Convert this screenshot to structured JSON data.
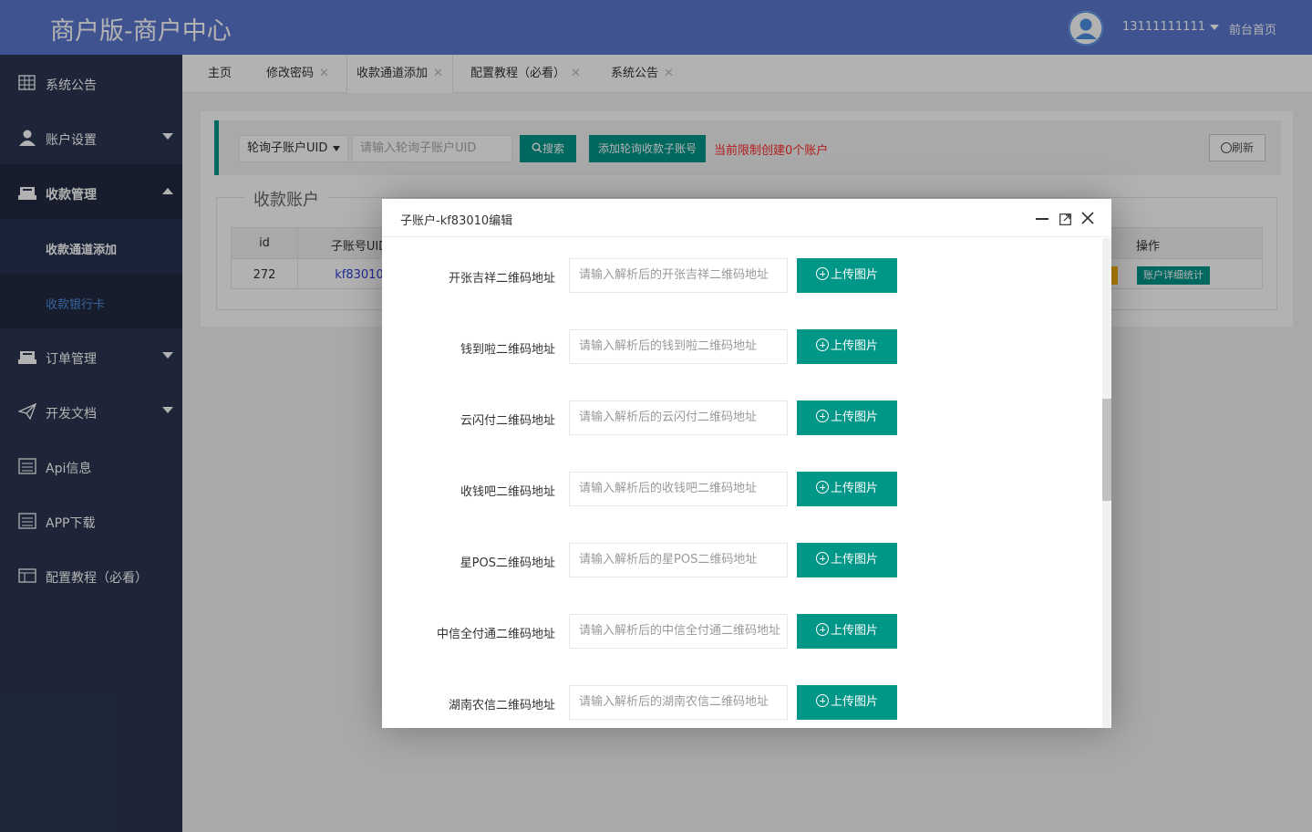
{
  "header": {
    "title": "商户版-商户中心",
    "user": "13111111111",
    "home_link": "前台首页"
  },
  "sidebar": {
    "items": [
      {
        "label": "系统公告",
        "icon": "grid-icon"
      },
      {
        "label": "账户设置",
        "icon": "user-icon"
      },
      {
        "label": "收款管理",
        "icon": "cash-icon"
      },
      {
        "label": "订单管理",
        "icon": "cash-icon"
      },
      {
        "label": "开发文档",
        "icon": "send-icon"
      },
      {
        "label": "Api信息",
        "icon": "list-icon"
      },
      {
        "label": "APP下载",
        "icon": "list-icon"
      },
      {
        "label": "配置教程（必看）",
        "icon": "window-icon"
      }
    ],
    "sub_items": [
      {
        "label": "收款通道添加"
      },
      {
        "label": "收款银行卡"
      }
    ]
  },
  "tabs": [
    {
      "label": "主页"
    },
    {
      "label": "修改密码"
    },
    {
      "label": "收款通道添加"
    },
    {
      "label": "配置教程（必看）"
    },
    {
      "label": "系统公告"
    }
  ],
  "toolbar": {
    "select_value": "轮询子账户UID",
    "search_placeholder": "请输入轮询子账户UID",
    "search_label": "搜索",
    "add_label": "添加轮询收款子账号",
    "limit_text": "当前限制创建0个账户",
    "refresh_label": "刷新"
  },
  "panel": {
    "legend": "收款账户",
    "columns": [
      "id",
      "子账号UID",
      "操作"
    ],
    "rows": [
      {
        "id": "272",
        "uid": "kf83010",
        "stat_label": "账户详细统计"
      }
    ]
  },
  "modal": {
    "title": "子账户-kf83010编辑",
    "upload_label": "上传图片",
    "fields": [
      {
        "label": "开张吉祥二维码地址",
        "placeholder": "请输入解析后的开张吉祥二维码地址"
      },
      {
        "label": "钱到啦二维码地址",
        "placeholder": "请输入解析后的钱到啦二维码地址"
      },
      {
        "label": "云闪付二维码地址",
        "placeholder": "请输入解析后的云闪付二维码地址"
      },
      {
        "label": "收钱吧二维码地址",
        "placeholder": "请输入解析后的收钱吧二维码地址"
      },
      {
        "label": "星POS二维码地址",
        "placeholder": "请输入解析后的星POS二维码地址"
      },
      {
        "label": "中信全付通二维码地址",
        "placeholder": "请输入解析后的中信全付通二维码地址"
      },
      {
        "label": "湖南农信二维码地址",
        "placeholder": "请输入解析后的湖南农信二维码地址"
      }
    ]
  },
  "colors": {
    "header": "#5b78cf",
    "sidebar": "#2b3651",
    "accent": "#009688",
    "warning": "#ff2a2a"
  }
}
